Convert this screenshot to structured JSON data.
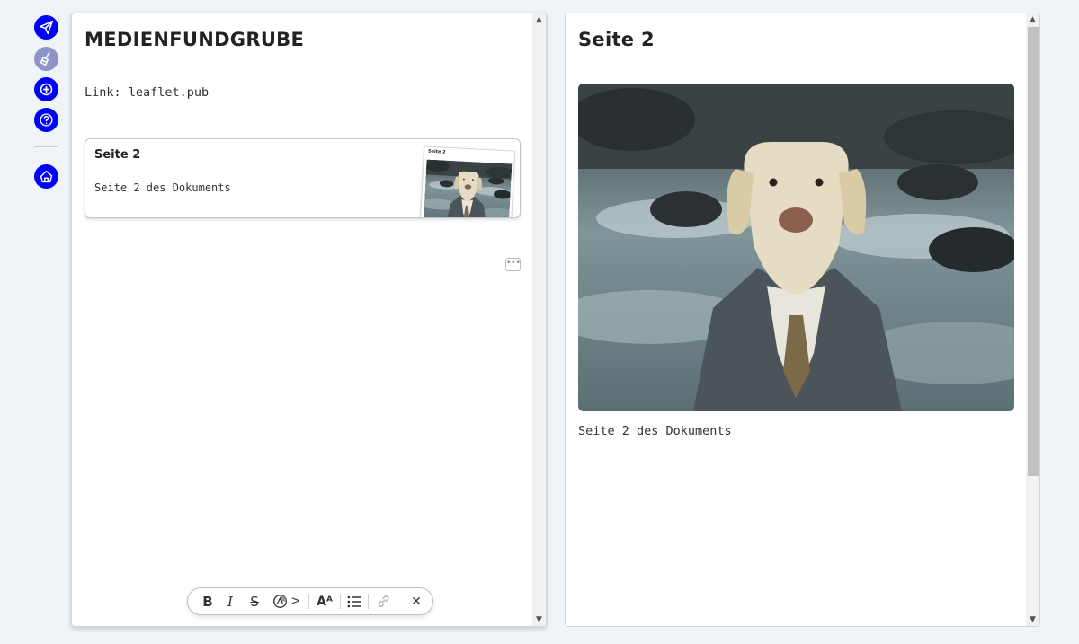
{
  "rail": {
    "icons": [
      "send-icon",
      "broom-icon",
      "add-icon",
      "help-icon",
      "home-icon"
    ]
  },
  "editor": {
    "title": "MEDIENFUNDGRUBE",
    "link_label": "Link:",
    "link_value": "leaflet.pub",
    "card": {
      "title": "Seite 2",
      "description": "Seite 2 des Dokuments",
      "thumb_title": "Seite 2"
    },
    "more_label": "•••"
  },
  "toolbar": {
    "bold": "B",
    "italic": "I",
    "strike": "S",
    "chevron": ">",
    "text_size": "Aᴬ",
    "close": "✕"
  },
  "preview": {
    "title": "Seite 2",
    "caption": "Seite 2 des Dokuments"
  },
  "colors": {
    "accent": "#0000ff",
    "accent_muted": "#8e95c6",
    "background": "#eef4f8"
  }
}
